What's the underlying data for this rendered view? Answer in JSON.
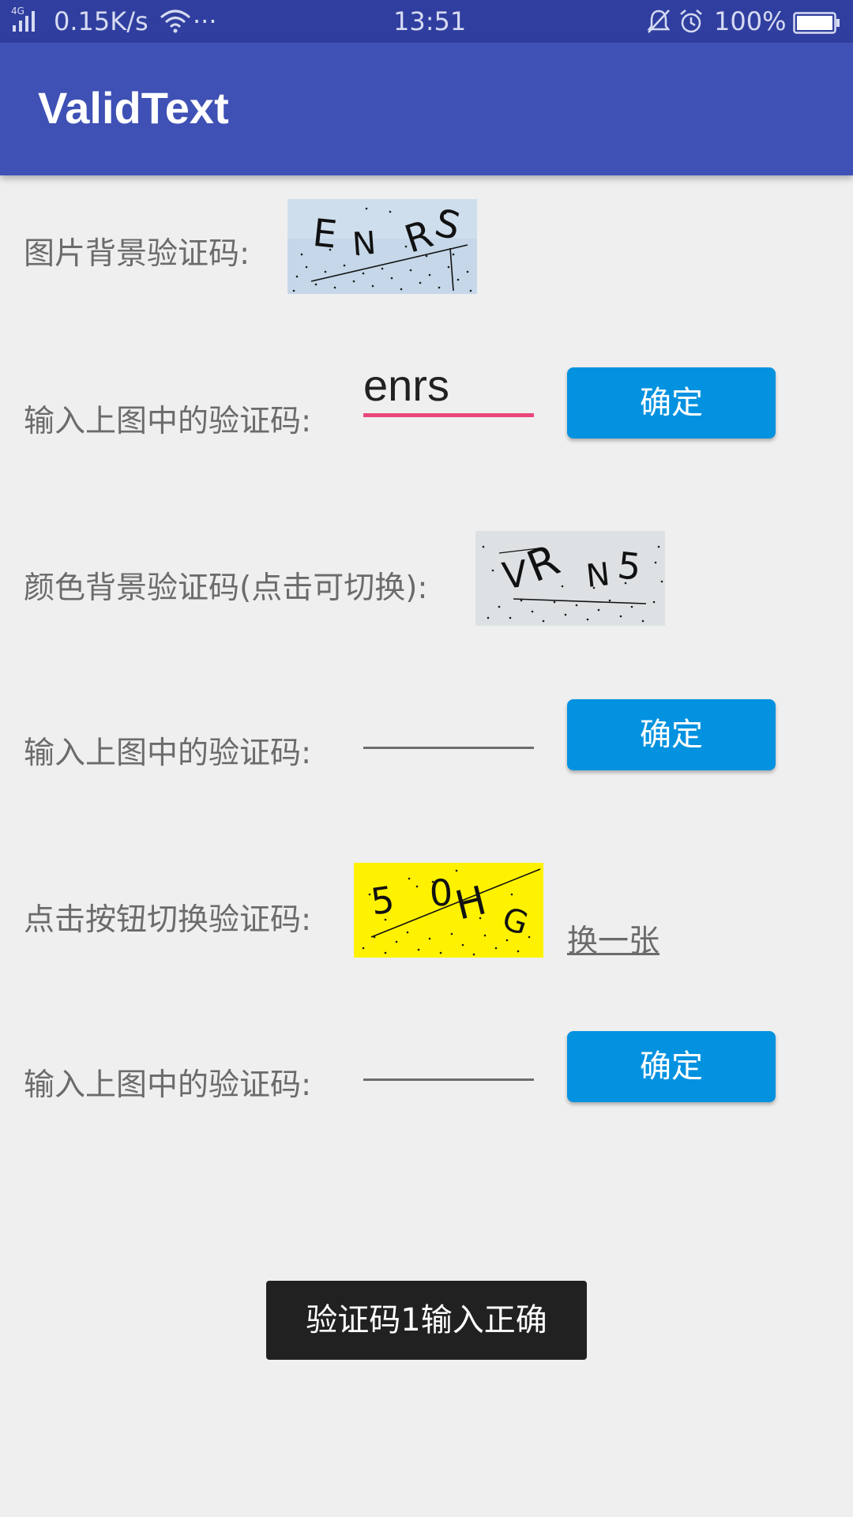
{
  "status_bar": {
    "network": "4G",
    "speed": "0.15K/s",
    "more": "···",
    "time": "13:51",
    "battery": "100%"
  },
  "app_bar": {
    "title": "ValidText"
  },
  "section1": {
    "label": "图片背景验证码:",
    "captcha_text": "ENRS",
    "captcha_bg": "#c5d7e8"
  },
  "input1": {
    "label": "输入上图中的验证码:",
    "value": "enrs",
    "button": "确定"
  },
  "section2": {
    "label": "颜色背景验证码(点击可切换):",
    "captcha_text": "VRN5",
    "captcha_bg": "#dde1e3"
  },
  "input2": {
    "label": "输入上图中的验证码:",
    "value": "",
    "button": "确定"
  },
  "section3": {
    "label": "点击按钮切换验证码:",
    "captcha_text": "50HG",
    "captcha_bg": "#fff200",
    "switch_link": "换一张"
  },
  "input3": {
    "label": "输入上图中的验证码:",
    "value": "",
    "button": "确定"
  },
  "toast": {
    "text": "验证码1输入正确"
  },
  "colors": {
    "primary_dark": "#303f9f",
    "primary": "#3f51b5",
    "accent": "#e94779",
    "button": "#0392e0"
  }
}
